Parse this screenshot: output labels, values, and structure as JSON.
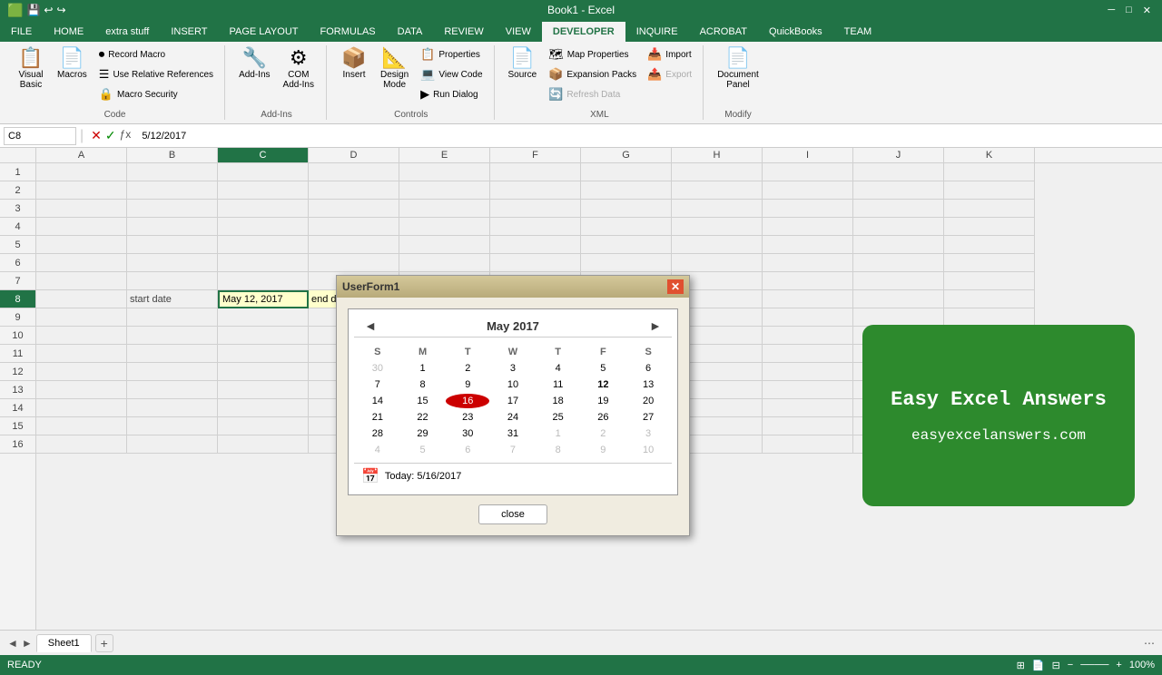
{
  "titlebar": {
    "app": "Book1 - Excel",
    "icons": [
      "⊞",
      "⊟",
      "✕"
    ]
  },
  "ribbon_tabs": [
    {
      "label": "FILE",
      "active": false
    },
    {
      "label": "HOME",
      "active": false
    },
    {
      "label": "extra stuff",
      "active": false
    },
    {
      "label": "INSERT",
      "active": false
    },
    {
      "label": "PAGE LAYOUT",
      "active": false
    },
    {
      "label": "FORMULAS",
      "active": false
    },
    {
      "label": "DATA",
      "active": false
    },
    {
      "label": "REVIEW",
      "active": false
    },
    {
      "label": "VIEW",
      "active": false
    },
    {
      "label": "DEVELOPER",
      "active": true
    },
    {
      "label": "INQUIRE",
      "active": false
    },
    {
      "label": "ACROBAT",
      "active": false
    },
    {
      "label": "QuickBooks",
      "active": false
    },
    {
      "label": "TEAM",
      "active": false
    }
  ],
  "ribbon_groups": {
    "code": {
      "label": "Code",
      "buttons": [
        {
          "label": "Visual\nBasic",
          "icon": "📋"
        },
        {
          "label": "Macros",
          "icon": "📄"
        }
      ],
      "small_buttons": [
        {
          "label": "Record Macro",
          "icon": "⏺"
        },
        {
          "label": "Use Relative References",
          "icon": "☰"
        },
        {
          "label": "Macro Security",
          "icon": "🔒"
        }
      ]
    },
    "addins": {
      "label": "Add-Ins",
      "buttons": [
        {
          "label": "Add-Ins",
          "icon": "🔧"
        },
        {
          "label": "COM\nAdd-Ins",
          "icon": "⚙"
        }
      ]
    },
    "controls": {
      "label": "Controls",
      "buttons": [
        {
          "label": "Insert",
          "icon": "📦"
        },
        {
          "label": "Design\nMode",
          "icon": "📐"
        }
      ],
      "small_buttons": [
        {
          "label": "Properties",
          "icon": "📋"
        },
        {
          "label": "View Code",
          "icon": "💻"
        },
        {
          "label": "Run Dialog",
          "icon": "▶"
        }
      ]
    },
    "xml": {
      "label": "XML",
      "buttons": [
        {
          "label": "Source",
          "icon": "📄"
        }
      ],
      "small_buttons": [
        {
          "label": "Map Properties",
          "icon": "🗺"
        },
        {
          "label": "Expansion Packs",
          "icon": "📦"
        },
        {
          "label": "Refresh Data",
          "icon": "🔄"
        },
        {
          "label": "Import",
          "icon": "📥"
        },
        {
          "label": "Export",
          "icon": "📤"
        }
      ]
    },
    "modify": {
      "label": "Modify",
      "buttons": [
        {
          "label": "Document\nPanel",
          "icon": "📄"
        }
      ]
    }
  },
  "formula_bar": {
    "name_box": "C8",
    "formula": "5/12/2017"
  },
  "columns": [
    "A",
    "B",
    "C",
    "D",
    "E",
    "F",
    "G",
    "H",
    "I",
    "J",
    "K"
  ],
  "rows": [
    "1",
    "2",
    "3",
    "4",
    "5",
    "6",
    "7",
    "8",
    "9",
    "10",
    "11",
    "12",
    "13",
    "14",
    "15",
    "16"
  ],
  "cell_data": {
    "B8": "start date",
    "C8": "May 12, 2017",
    "D8": "end date"
  },
  "userform": {
    "title": "UserForm1",
    "calendar": {
      "month": "May 2017",
      "days_header": [
        "",
        "S",
        "M",
        "T",
        "W",
        "T",
        "F",
        "S"
      ],
      "weeks": [
        [
          {
            "day": "30",
            "other": true
          },
          {
            "day": "1",
            "other": false
          },
          {
            "day": "2",
            "other": false
          },
          {
            "day": "3",
            "other": false
          },
          {
            "day": "4",
            "other": false
          },
          {
            "day": "5",
            "other": false
          },
          {
            "day": "6",
            "other": false
          }
        ],
        [
          {
            "day": "7",
            "other": false
          },
          {
            "day": "8",
            "other": false
          },
          {
            "day": "9",
            "other": false
          },
          {
            "day": "10",
            "other": false
          },
          {
            "day": "11",
            "other": false
          },
          {
            "day": "12",
            "other": false
          },
          {
            "day": "13",
            "other": false
          }
        ],
        [
          {
            "day": "14",
            "other": false
          },
          {
            "day": "15",
            "other": false
          },
          {
            "day": "16",
            "other": false,
            "selected": true
          },
          {
            "day": "17",
            "other": false
          },
          {
            "day": "18",
            "other": false
          },
          {
            "day": "19",
            "other": false
          },
          {
            "day": "20",
            "other": false
          }
        ],
        [
          {
            "day": "21",
            "other": false
          },
          {
            "day": "22",
            "other": false
          },
          {
            "day": "23",
            "other": false
          },
          {
            "day": "24",
            "other": false
          },
          {
            "day": "25",
            "other": false
          },
          {
            "day": "26",
            "other": false
          },
          {
            "day": "27",
            "other": false
          }
        ],
        [
          {
            "day": "28",
            "other": false
          },
          {
            "day": "29",
            "other": false
          },
          {
            "day": "30",
            "other": false
          },
          {
            "day": "31",
            "other": false
          },
          {
            "day": "1",
            "other": true
          },
          {
            "day": "2",
            "other": true
          },
          {
            "day": "3",
            "other": true
          }
        ],
        [
          {
            "day": "4",
            "other": true
          },
          {
            "day": "5",
            "other": true
          },
          {
            "day": "6",
            "other": true
          },
          {
            "day": "7",
            "other": true
          },
          {
            "day": "8",
            "other": true
          },
          {
            "day": "9",
            "other": true
          },
          {
            "day": "10",
            "other": true
          }
        ]
      ],
      "today": "Today: 5/16/2017",
      "close_btn": "close"
    }
  },
  "banner": {
    "title": "Easy  Excel  Answers",
    "url": "easyexcelanswers.com"
  },
  "sheet_tabs": [
    {
      "label": "Sheet1",
      "active": true
    }
  ],
  "status": {
    "ready": "READY"
  }
}
